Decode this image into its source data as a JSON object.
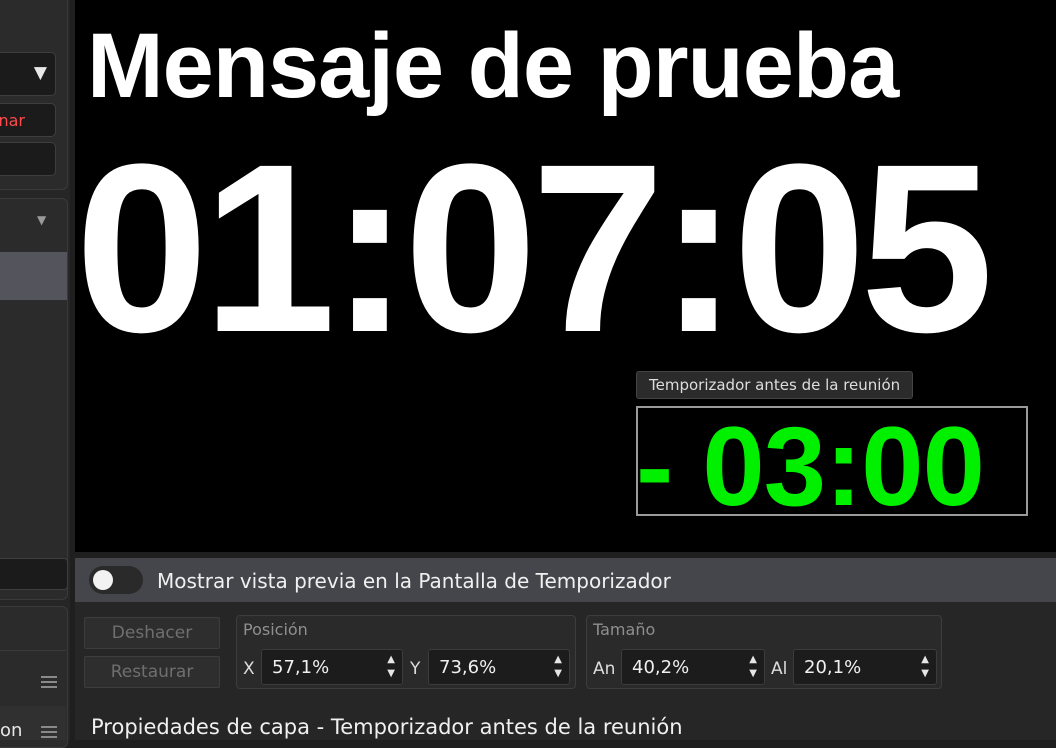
{
  "sidebar": {
    "remove_label_fragment": "nar",
    "list_item_fragment": "on"
  },
  "preview": {
    "message": "Mensaje de prueba",
    "clock": "01:07:05",
    "timer_tooltip": "Temporizador antes de la reunión",
    "timer_value": "- 03:00",
    "timer_color": "#00f000"
  },
  "preview_toggle": {
    "label": "Mostrar vista previa en la Pantalla de Temporizador",
    "enabled": false
  },
  "actions": {
    "undo_label": "Deshacer",
    "reset_label": "Restaurar"
  },
  "position": {
    "title": "Posición",
    "x_label": "X",
    "x_value": "57,1%",
    "y_label": "Y",
    "y_value": "73,6%"
  },
  "size": {
    "title": "Tamaño",
    "width_label": "An",
    "width_value": "40,2%",
    "height_label": "Al",
    "height_value": "20,1%"
  },
  "layer_properties_title": "Propiedades de capa - Temporizador antes de la reunión"
}
